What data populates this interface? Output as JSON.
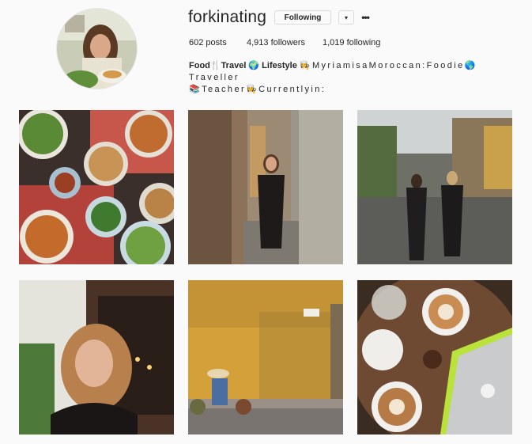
{
  "profile": {
    "username": "forkinating",
    "follow_label": "Following",
    "dropdown_label": "▾",
    "more_label": "•••",
    "stats": {
      "posts": "602 posts",
      "followers": "4,913 followers",
      "following": "1,019 following"
    },
    "bio": {
      "name": "Food🍴Travel 🌍 Lifestyle",
      "line1": "👩‍🍳MyriamisaMoroccan:Foodie🌎Traveller",
      "line2": "📚Teacher👩‍🍳Currentlyin:"
    }
  },
  "posts": [
    {
      "subject": "vietnamese-food-spread"
    },
    {
      "subject": "woman-in-alley"
    },
    {
      "subject": "two-women-walking-street"
    },
    {
      "subject": "woman-laughing-portrait"
    },
    {
      "subject": "vendor-by-yellow-wall"
    },
    {
      "subject": "coffee-and-laptop"
    }
  ],
  "icons": {
    "dropdown": "chevron-down-icon",
    "more": "more-options-icon"
  },
  "colors": {
    "background": "#fafafa",
    "text": "#262626",
    "border": "#dbdbdb"
  }
}
